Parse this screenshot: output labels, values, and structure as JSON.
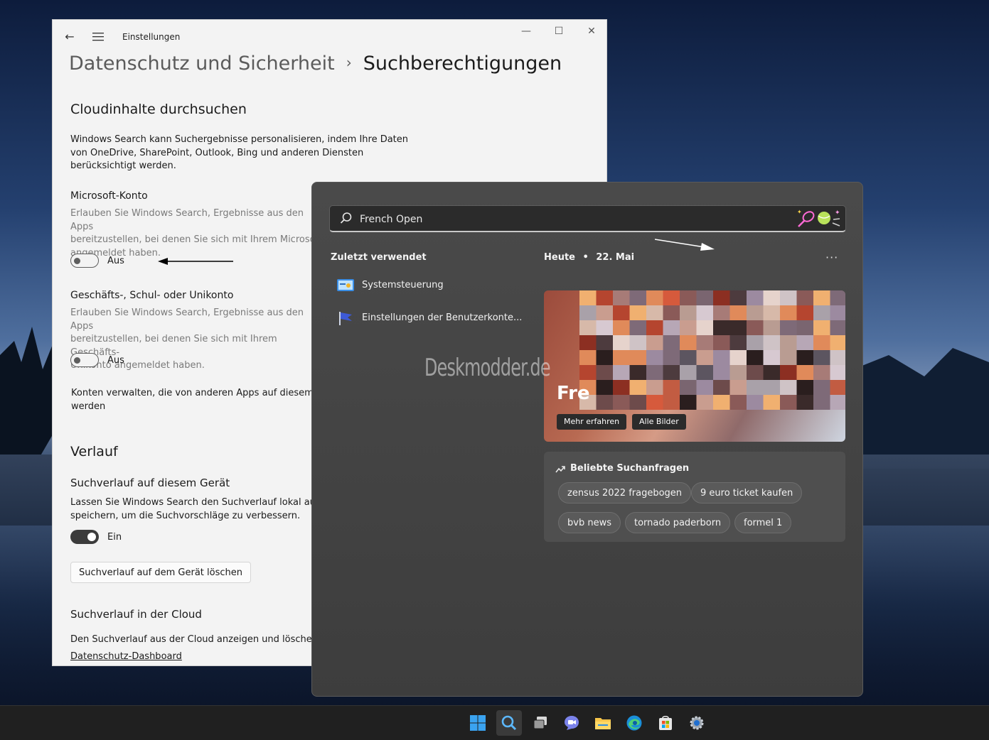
{
  "settings": {
    "app_title": "Einstellungen",
    "breadcrumb_parent": "Datenschutz und Sicherheit",
    "breadcrumb_separator": "›",
    "page_title": "Suchberechtigungen",
    "cloud_heading": "Cloudinhalte durchsuchen",
    "cloud_desc": [
      "Windows Search kann Suchergebnisse personalisieren, indem Ihre Daten",
      "von OneDrive, SharePoint, Outlook, Bing und anderen Diensten",
      "berücksichtigt werden."
    ],
    "ms_account": {
      "label": "Microsoft-Konto",
      "desc": [
        "Erlauben Sie Windows Search, Ergebnisse aus den Apps",
        "bereitzustellen, bei denen Sie sich mit Ihrem Microsoft-",
        "angemeldet haben."
      ],
      "toggle": "Aus"
    },
    "work_account": {
      "label": "Geschäfts-, Schul- oder Unikonto",
      "desc": [
        "Erlauben Sie Windows Search, Ergebnisse aus den Apps",
        "bereitzustellen, bei denen Sie sich mit Ihrem Geschäfts-",
        "Unikonto angemeldet haben."
      ],
      "toggle": "Aus"
    },
    "manage_accounts": [
      "Konten verwalten, die von anderen Apps auf diesem Ge",
      "werden"
    ],
    "history_heading": "Verlauf",
    "device_history": {
      "label": "Suchverlauf auf diesem Gerät",
      "desc": [
        "Lassen Sie Windows Search den Suchverlauf lokal auf d",
        "speichern, um die Suchvorschläge zu verbessern."
      ],
      "toggle": "Ein"
    },
    "clear_button": "Suchverlauf auf dem Gerät löschen",
    "cloud_history_label": "Suchverlauf in der Cloud",
    "cloud_history_desc": "Den Suchverlauf aus der Cloud anzeigen und löschen",
    "dashboard_link": "Datenschutz-Dashboard"
  },
  "search": {
    "query": "French Open",
    "recent_heading": "Zuletzt verwendet",
    "recent_items": [
      "Systemsteuerung",
      "Einstellungen der Benutzerkonte..."
    ],
    "today_label": "Heute",
    "date": "22. Mai",
    "more": "···",
    "card_title": "Fre",
    "learn_more": "Mehr erfahren",
    "all_images": "Alle Bilder",
    "popular_heading": "Beliebte Suchanfragen",
    "popular": [
      "zensus 2022 fragebogen",
      "9 euro ticket kaufen",
      "bvb news",
      "tornado paderborn",
      "formel 1"
    ]
  },
  "watermark": "Deskmodder.de",
  "taskbar": {
    "icons": [
      "start-icon",
      "search-icon",
      "task-view-icon",
      "chat-icon",
      "file-explorer-icon",
      "edge-icon",
      "store-icon",
      "settings-icon"
    ]
  }
}
